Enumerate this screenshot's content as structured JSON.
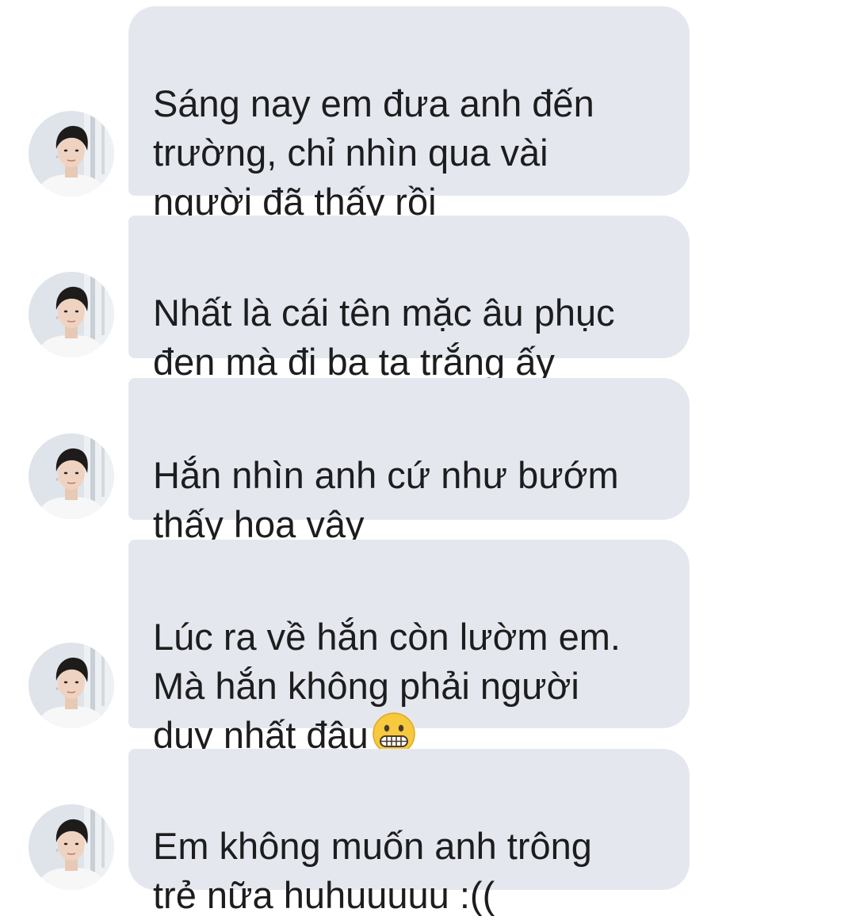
{
  "chat": {
    "messages": [
      {
        "text": "Sáng nay em đưa anh đến\ntrường, chỉ nhìn qua vài\nngười đã thấy rồi"
      },
      {
        "text": "Nhất là cái tên mặc âu phục\nđen mà đi ba ta trắng ấy"
      },
      {
        "text": "Hắn nhìn anh cứ như bướm\nthấy hoa vậy"
      },
      {
        "text": "Lúc ra về hắn còn lườm em.\nMà hắn không phải người\nduy nhất đâu",
        "emoji": "grimacing-face-emoji"
      },
      {
        "text": "Em không muốn anh trông\ntrẻ nữa huhuuuuu :(("
      }
    ],
    "avatar_icon": "profile-photo-avatar",
    "colors": {
      "bubble": "#e4e8ee",
      "text": "#1d1d1f",
      "background": "#ffffff"
    }
  }
}
